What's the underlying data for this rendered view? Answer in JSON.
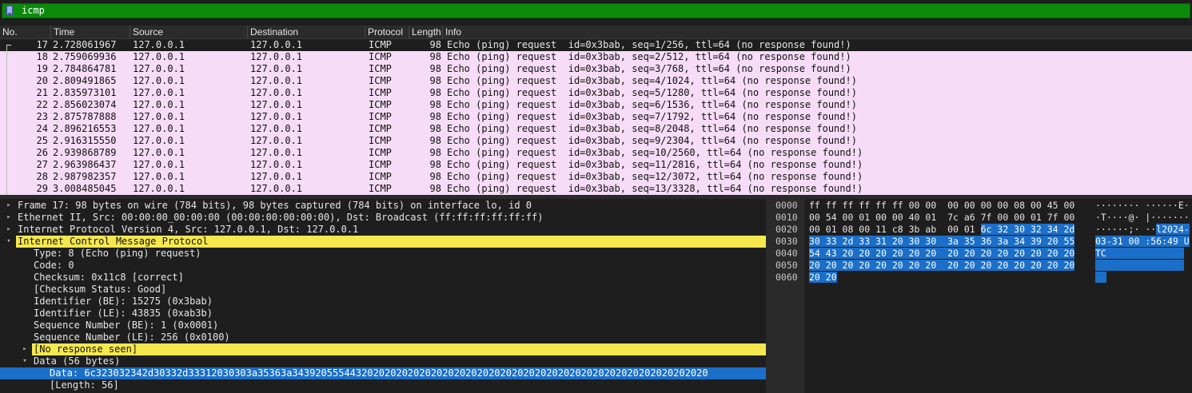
{
  "filter": {
    "value": "icmp",
    "icon": "bookmark-icon"
  },
  "packet_list": {
    "columns": [
      "No.",
      "Time",
      "Source",
      "Destination",
      "Protocol",
      "Length",
      "Info"
    ],
    "rows": [
      [
        "17",
        "2.728061967",
        "127.0.0.1",
        "127.0.0.1",
        "ICMP",
        "98",
        "Echo (ping) request  id=0x3bab, seq=1/256, ttl=64 (no response found!)"
      ],
      [
        "18",
        "2.759069936",
        "127.0.0.1",
        "127.0.0.1",
        "ICMP",
        "98",
        "Echo (ping) request  id=0x3bab, seq=2/512, ttl=64 (no response found!)"
      ],
      [
        "19",
        "2.784864781",
        "127.0.0.1",
        "127.0.0.1",
        "ICMP",
        "98",
        "Echo (ping) request  id=0x3bab, seq=3/768, ttl=64 (no response found!)"
      ],
      [
        "20",
        "2.809491865",
        "127.0.0.1",
        "127.0.0.1",
        "ICMP",
        "98",
        "Echo (ping) request  id=0x3bab, seq=4/1024, ttl=64 (no response found!)"
      ],
      [
        "21",
        "2.835973101",
        "127.0.0.1",
        "127.0.0.1",
        "ICMP",
        "98",
        "Echo (ping) request  id=0x3bab, seq=5/1280, ttl=64 (no response found!)"
      ],
      [
        "22",
        "2.856023074",
        "127.0.0.1",
        "127.0.0.1",
        "ICMP",
        "98",
        "Echo (ping) request  id=0x3bab, seq=6/1536, ttl=64 (no response found!)"
      ],
      [
        "23",
        "2.875787888",
        "127.0.0.1",
        "127.0.0.1",
        "ICMP",
        "98",
        "Echo (ping) request  id=0x3bab, seq=7/1792, ttl=64 (no response found!)"
      ],
      [
        "24",
        "2.896216553",
        "127.0.0.1",
        "127.0.0.1",
        "ICMP",
        "98",
        "Echo (ping) request  id=0x3bab, seq=8/2048, ttl=64 (no response found!)"
      ],
      [
        "25",
        "2.916315550",
        "127.0.0.1",
        "127.0.0.1",
        "ICMP",
        "98",
        "Echo (ping) request  id=0x3bab, seq=9/2304, ttl=64 (no response found!)"
      ],
      [
        "26",
        "2.939868789",
        "127.0.0.1",
        "127.0.0.1",
        "ICMP",
        "98",
        "Echo (ping) request  id=0x3bab, seq=10/2560, ttl=64 (no response found!)"
      ],
      [
        "27",
        "2.963986437",
        "127.0.0.1",
        "127.0.0.1",
        "ICMP",
        "98",
        "Echo (ping) request  id=0x3bab, seq=11/2816, ttl=64 (no response found!)"
      ],
      [
        "28",
        "2.987982357",
        "127.0.0.1",
        "127.0.0.1",
        "ICMP",
        "98",
        "Echo (ping) request  id=0x3bab, seq=12/3072, ttl=64 (no response found!)"
      ],
      [
        "29",
        "3.008485045",
        "127.0.0.1",
        "127.0.0.1",
        "ICMP",
        "98",
        "Echo (ping) request  id=0x3bab, seq=13/3328, ttl=64 (no response found!)"
      ]
    ]
  },
  "details": [
    {
      "text": "Frame 17: 98 bytes on wire (784 bits), 98 bytes captured (784 bits) on interface lo, id 0",
      "indent": 0,
      "arrow": "collapsed",
      "hl": ""
    },
    {
      "text": "Ethernet II, Src: 00:00:00_00:00:00 (00:00:00:00:00:00), Dst: Broadcast (ff:ff:ff:ff:ff:ff)",
      "indent": 0,
      "arrow": "collapsed",
      "hl": ""
    },
    {
      "text": "Internet Protocol Version 4, Src: 127.0.0.1, Dst: 127.0.0.1",
      "indent": 0,
      "arrow": "collapsed",
      "hl": ""
    },
    {
      "text": "Internet Control Message Protocol",
      "indent": 0,
      "arrow": "expanded",
      "hl": "yellow-full"
    },
    {
      "text": "Type: 8 (Echo (ping) request)",
      "indent": 1,
      "arrow": "",
      "hl": ""
    },
    {
      "text": "Code: 0",
      "indent": 1,
      "arrow": "",
      "hl": ""
    },
    {
      "text": "Checksum: 0x11c8 [correct]",
      "indent": 1,
      "arrow": "",
      "hl": ""
    },
    {
      "text": "[Checksum Status: Good]",
      "indent": 1,
      "arrow": "",
      "hl": ""
    },
    {
      "text": "Identifier (BE): 15275 (0x3bab)",
      "indent": 1,
      "arrow": "",
      "hl": ""
    },
    {
      "text": "Identifier (LE): 43835 (0xab3b)",
      "indent": 1,
      "arrow": "",
      "hl": ""
    },
    {
      "text": "Sequence Number (BE): 1 (0x0001)",
      "indent": 1,
      "arrow": "",
      "hl": ""
    },
    {
      "text": "Sequence Number (LE): 256 (0x0100)",
      "indent": 1,
      "arrow": "",
      "hl": ""
    },
    {
      "text": "[No response seen]",
      "indent": 1,
      "arrow": "collapsed",
      "hl": "yellow-full"
    },
    {
      "text": "Data (56 bytes)",
      "indent": 1,
      "arrow": "expanded",
      "hl": ""
    },
    {
      "text": "Data: 6c323032342d30332d33312030303a35363a343920555443202020202020202020202020202020202020202020202020202020202020",
      "indent": 2,
      "arrow": "",
      "hl": "blue"
    },
    {
      "text": "[Length: 56]",
      "indent": 2,
      "arrow": "",
      "hl": ""
    }
  ],
  "bytes": [
    {
      "offset": "0000",
      "hex_plain": "ff ff ff ff ff ff 00 00  00 00 00 00 08 00 45 00",
      "hex_sel": "",
      "asc_plain": "········ ······E·",
      "asc_sel": ""
    },
    {
      "offset": "0010",
      "hex_plain": "00 54 00 01 00 00 40 01  7c a6 7f 00 00 01 7f 00",
      "hex_sel": "",
      "asc_plain": "·T····@· |·······",
      "asc_sel": ""
    },
    {
      "offset": "0020",
      "hex_plain": "00 01 08 00 11 c8 3b ab  00 01 ",
      "hex_sel": "6c 32 30 32 34 2d",
      "asc_plain": "······;· ··",
      "asc_sel": "l2024-"
    },
    {
      "offset": "0030",
      "hex_plain": "",
      "hex_sel": "30 33 2d 33 31 20 30 30  3a 35 36 3a 34 39 20 55",
      "asc_plain": "",
      "asc_sel": "03-31 00 :56:49 U"
    },
    {
      "offset": "0040",
      "hex_plain": "",
      "hex_sel": "54 43 20 20 20 20 20 20  20 20 20 20 20 20 20 20",
      "asc_plain": "",
      "asc_sel": "TC              "
    },
    {
      "offset": "0050",
      "hex_plain": "",
      "hex_sel": "20 20 20 20 20 20 20 20  20 20 20 20 20 20 20 20",
      "asc_plain": "",
      "asc_sel": "                "
    },
    {
      "offset": "0060",
      "hex_plain": "",
      "hex_sel": "20 20",
      "asc_plain": "",
      "asc_sel": "  "
    }
  ],
  "colors": {
    "filter_valid": "#0b8a0b",
    "row_icmp": "#f6dcf6",
    "selection": "#1b6fc8",
    "expert_warn": "#f5e84f"
  }
}
